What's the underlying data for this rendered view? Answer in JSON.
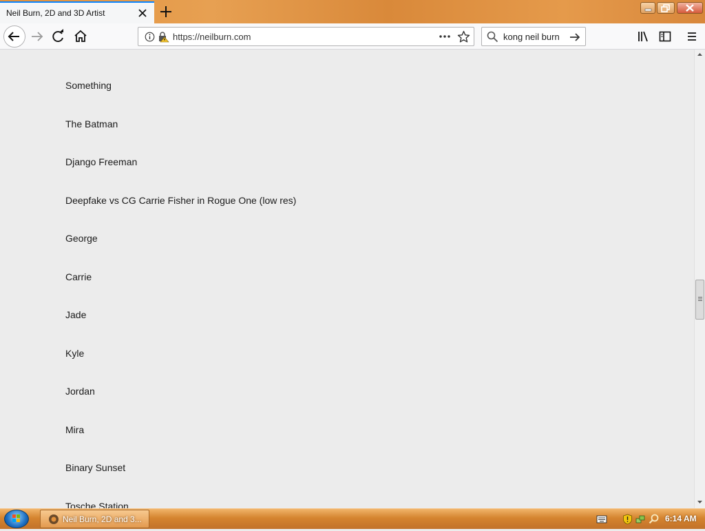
{
  "browser": {
    "tab": {
      "title": "Neil Burn, 2D and 3D Artist"
    },
    "url": "https://neilburn.com",
    "search": {
      "value": "kong neil burn"
    }
  },
  "page": {
    "items": [
      "Something",
      "The Batman",
      "Django Freeman",
      "Deepfake vs CG Carrie Fisher in Rogue One (low res)",
      "George",
      "Carrie",
      "Jade",
      "Kyle",
      "Jordan",
      "Mira",
      "Binary Sunset",
      "Tosche Station"
    ]
  },
  "taskbar": {
    "task_label": "Neil Burn, 2D and 3...",
    "clock": "6:14 AM"
  }
}
